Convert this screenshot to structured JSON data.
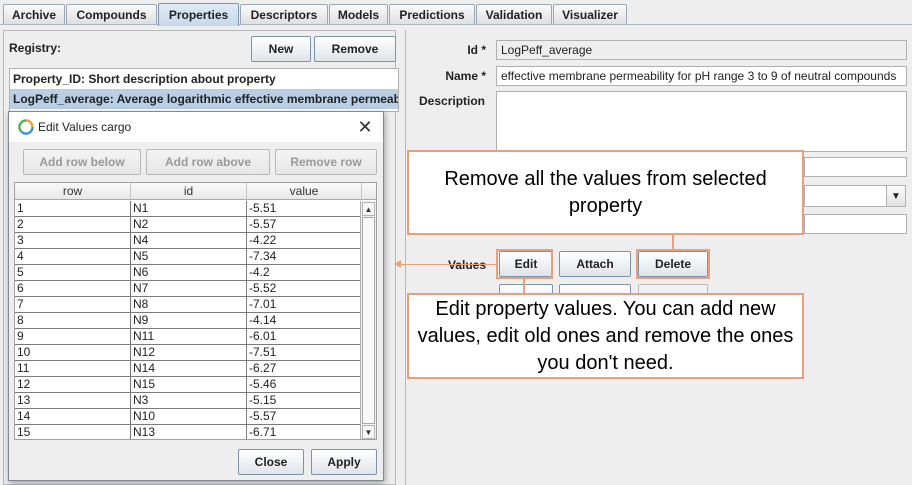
{
  "tabs": [
    {
      "label": "Archive"
    },
    {
      "label": "Compounds"
    },
    {
      "label": "Properties",
      "active": true
    },
    {
      "label": "Descriptors"
    },
    {
      "label": "Models"
    },
    {
      "label": "Predictions"
    },
    {
      "label": "Validation"
    },
    {
      "label": "Visualizer"
    }
  ],
  "registry": {
    "label": "Registry:",
    "new_label": "New",
    "remove_label": "Remove",
    "rows": [
      "Property_ID: Short description about property",
      "LogPeff_average: Average logarithmic effective membrane permeability"
    ]
  },
  "dialog": {
    "title": "Edit Values cargo",
    "add_below": "Add row below",
    "add_above": "Add row above",
    "remove_row": "Remove row",
    "columns": [
      "row",
      "id",
      "value"
    ],
    "rows": [
      [
        "1",
        "N1",
        "-5.51"
      ],
      [
        "2",
        "N2",
        "-5.57"
      ],
      [
        "3",
        "N4",
        "-4.22"
      ],
      [
        "4",
        "N5",
        "-7.34"
      ],
      [
        "5",
        "N6",
        "-4.2"
      ],
      [
        "6",
        "N7",
        "-5.52"
      ],
      [
        "7",
        "N8",
        "-7.01"
      ],
      [
        "8",
        "N9",
        "-4.14"
      ],
      [
        "9",
        "N11",
        "-6.01"
      ],
      [
        "10",
        "N12",
        "-7.51"
      ],
      [
        "11",
        "N14",
        "-6.27"
      ],
      [
        "12",
        "N15",
        "-5.46"
      ],
      [
        "13",
        "N3",
        "-5.15"
      ],
      [
        "14",
        "N10",
        "-5.57"
      ],
      [
        "15",
        "N13",
        "-6.71"
      ]
    ],
    "close_label": "Close",
    "apply_label": "Apply"
  },
  "property": {
    "id_label": "Id *",
    "id_value": "LogPeff_average",
    "name_label": "Name *",
    "name_value": "effective membrane permeability for pH range 3 to 9 of neutral compounds",
    "description_label": "Description",
    "values_label": "Values",
    "edit_label": "Edit",
    "attach_label": "Attach",
    "delete_label": "Delete"
  },
  "callouts": {
    "delete_text": "Remove all the values from selected property",
    "edit_text": "Edit property values. You can add new values, edit old ones and remove the ones you don't need."
  },
  "colors": {
    "accent": "#e8a07a",
    "selection": "#b8cfe5",
    "tab_active": "#c5d8ec"
  }
}
